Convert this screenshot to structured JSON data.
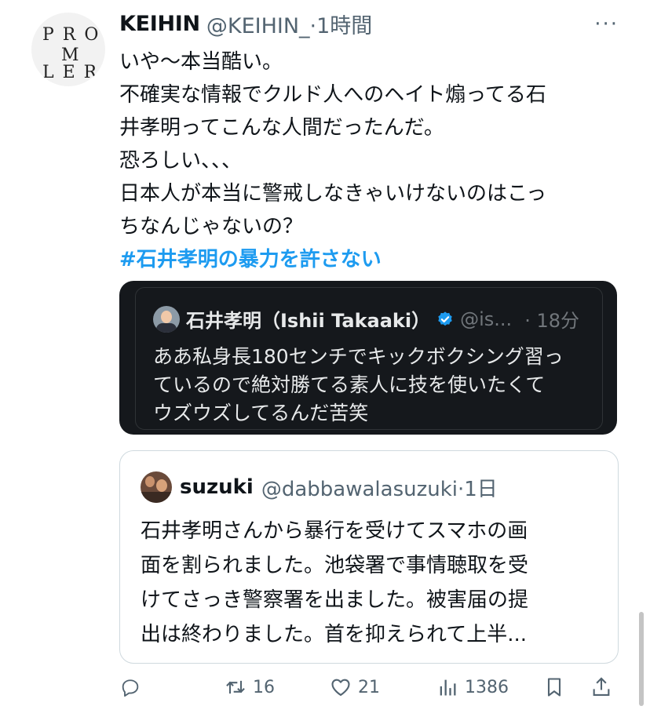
{
  "tweet": {
    "avatar_letters": [
      "P R O",
      "M",
      "L E R"
    ],
    "author_name": "KEIHIN",
    "author_handle_time": "@KEIHIN_·1時間",
    "more_label": "···",
    "lines": [
      "いや〜本当酷い。",
      "不確実な情報でクルド人へのヘイト煽ってる石",
      "井孝明ってこんな人間だったんだ。",
      "恐ろしい、、、",
      "日本人が本当に警戒しなきゃいけないのはこっ",
      "ちなんじゃないの？"
    ],
    "hashtag": "#石井孝明の暴力を許さない"
  },
  "quoted_dark": {
    "name": "石井孝明（Ishii Takaaki）",
    "handle": "@is...",
    "time": "· 18分",
    "lines": [
      "ああ私身長180センチでキックボクシング習っ",
      "ているので絶対勝てる素人に技を使いたくて",
      "ウズウズしてるんだ苦笑"
    ]
  },
  "quoted_light": {
    "name": "suzuki",
    "handle_time": "@dabbawalasuzuki·1日",
    "lines": [
      "石井孝明さんから暴行を受けてスマホの画",
      "面を割られました。池袋署で事情聴取を受",
      "けてさっき警察署を出ました。被害届の提",
      "出は終わりました。首を抑えられて上半..."
    ]
  },
  "actions": {
    "reply_icon": "reply-icon",
    "retweet_count": "16",
    "like_count": "21",
    "views_count": "1386",
    "bookmark_icon": "bookmark-icon",
    "share_icon": "share-icon"
  },
  "colors": {
    "accent": "#1d9bf0",
    "secondary_text": "#536471",
    "dark_card_bg": "#15181c"
  }
}
